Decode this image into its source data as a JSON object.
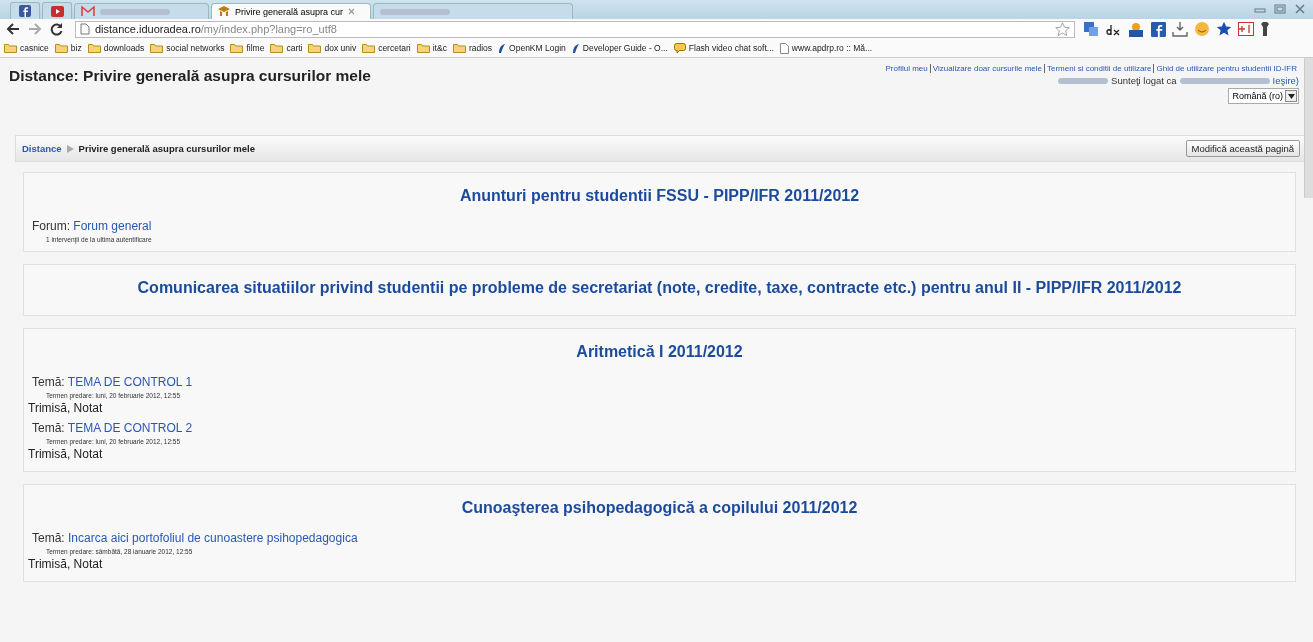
{
  "browser": {
    "tabs": [
      {
        "label": "Privire generală asupra cur",
        "selected": true
      }
    ],
    "address": {
      "host": "distance.iduoradea.ro",
      "path": "/my/index.php?lang=ro_utf8"
    },
    "bookmarks": [
      {
        "kind": "folder",
        "label": "casnice"
      },
      {
        "kind": "folder",
        "label": "biz"
      },
      {
        "kind": "folder",
        "label": "downloads"
      },
      {
        "kind": "folder",
        "label": "social networks"
      },
      {
        "kind": "folder",
        "label": "filme"
      },
      {
        "kind": "folder",
        "label": "carti"
      },
      {
        "kind": "folder",
        "label": "dox univ"
      },
      {
        "kind": "folder",
        "label": "cercetari"
      },
      {
        "kind": "folder",
        "label": "it&c"
      },
      {
        "kind": "folder",
        "label": "radios"
      },
      {
        "kind": "site",
        "label": "OpenKM Login"
      },
      {
        "kind": "site",
        "label": "Developer Guide - O..."
      },
      {
        "kind": "chat",
        "label": "Flash video chat soft..."
      },
      {
        "kind": "page",
        "label": "www.apdrp.ro :: Mă..."
      }
    ]
  },
  "page": {
    "title": "Distance: Privire generală asupra cursurilor mele",
    "header_links": [
      "Profilul meu",
      "Vizualizare doar cursurile mele",
      "Termeni si conditii de utilizare",
      "Ghid de utilizare pentru studentii ID-IFR"
    ],
    "login_text": "Sunteţi logat ca",
    "logout_link": "Ieşire)",
    "language": "Română (ro)",
    "breadcrumb": {
      "home": "Distance",
      "current": "Privire generală asupra cursurilor mele"
    },
    "edit_button": "Modifică această pagină",
    "courses": [
      {
        "title": "Anunturi pentru studentii FSSU - PIPP/IFR 2011/2012",
        "items": [
          {
            "kind": "forum",
            "label": "Forum:",
            "link": "Forum general",
            "note": "1 intervenţii de la ultima autentificare"
          }
        ]
      },
      {
        "title": "Comunicarea situatiilor privind studentii pe probleme de secretariat (note, credite, taxe, contracte etc.) pentru anul II - PIPP/IFR 2011/2012"
      },
      {
        "title": "Aritmetică I 2011/2012",
        "items": [
          {
            "kind": "assignment",
            "label": "Temă:",
            "link": "TEMA DE CONTROL 1",
            "due": "Termen predare: luni, 20 februarie 2012, 12:55",
            "status": "Trimisă, Notat"
          },
          {
            "kind": "assignment",
            "label": "Temă:",
            "link": "TEMA DE CONTROL 2",
            "due": "Termen predare: luni, 20 februarie 2012, 12:55",
            "status": "Trimisă, Notat"
          }
        ]
      },
      {
        "title": "Cunoaşterea psihopedagogică a copilului 2011/2012",
        "items": [
          {
            "kind": "assignment",
            "label": "Temă:",
            "link": "Incarca aici portofoliul de cunoastere psihopedagogica",
            "due": "Termen predare: sâmbătă, 28 ianuarie 2012, 12:55",
            "status": "Trimisă, Notat"
          }
        ]
      }
    ]
  }
}
